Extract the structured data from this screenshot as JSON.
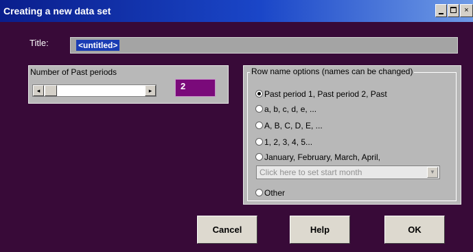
{
  "window": {
    "title": "Creating a new data set",
    "controls": {
      "minimize": "minimize-icon",
      "maximize": "maximize-icon",
      "close": "×"
    }
  },
  "title_field": {
    "label": "Title:",
    "value": "<untitled>"
  },
  "periods": {
    "label": "Number of Past periods",
    "value": "2",
    "scroll_left": "◂",
    "scroll_right": "▸",
    "slider_level": 0.05
  },
  "row_name_options": {
    "legend": "Row name options (names can be changed)",
    "options": [
      "Past period 1, Past period 2, Past",
      "a, b, c, d, e, ...",
      "A, B, C, D, E, ...",
      "1, 2, 3, 4, 5...",
      "January, February, March, April,",
      "Other"
    ],
    "selected_index": 0,
    "month_select": {
      "placeholder": "Click here to set start month",
      "arrow": "▼"
    }
  },
  "buttons": {
    "cancel": "Cancel",
    "help": "Help",
    "ok": "OK"
  },
  "colors": {
    "background": "#380a38",
    "titlebar": "#1a46c8",
    "count_box": "#7a0a7a",
    "panel": "#b8b8b8"
  }
}
